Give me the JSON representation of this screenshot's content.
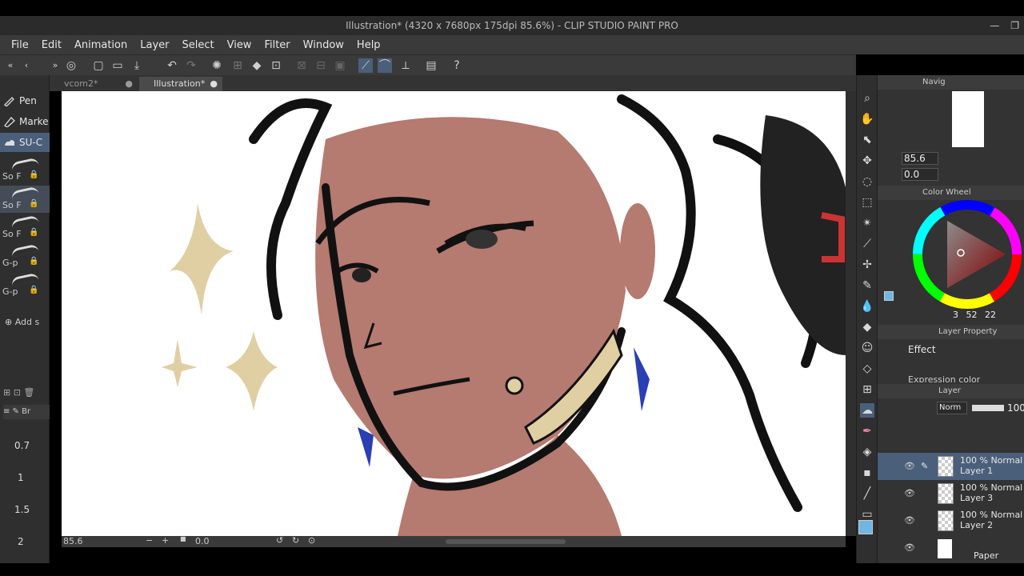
{
  "window": {
    "title": "Illustration* (4320 x 7680px 175dpi 85.6%) - CLIP STUDIO PAINT PRO",
    "minimize": "—",
    "restore": "❐"
  },
  "menu": [
    "File",
    "Edit",
    "Animation",
    "Layer",
    "Select",
    "View",
    "Filter",
    "Window",
    "Help"
  ],
  "left_panel": {
    "tools": [
      {
        "label": "Pen",
        "icon": "pen-icon",
        "selected": false
      },
      {
        "label": "Marke",
        "icon": "marker-icon",
        "selected": false
      },
      {
        "label": "SU-C",
        "icon": "cloud-brush-icon",
        "selected": true
      }
    ],
    "brushes": [
      {
        "label": "So F",
        "selected": false
      },
      {
        "label": "So F",
        "selected": true
      },
      {
        "label": "So F",
        "selected": false
      },
      {
        "label": "G-p",
        "selected": false
      },
      {
        "label": "G-p",
        "selected": false
      }
    ],
    "add_label": "Add s",
    "brush_size_hdr": "Br",
    "sizes": [
      "0.7",
      "1",
      "1.5",
      "2"
    ]
  },
  "doc_tabs": [
    {
      "label": "vcom2*",
      "active": false
    },
    {
      "label": "Illustration*",
      "active": true
    }
  ],
  "canvas_bar": {
    "zoom": "85.6",
    "angle": "0.0"
  },
  "navigator": {
    "tab": "Navig",
    "zoom": "85.6",
    "angle": "0.0"
  },
  "color_wheel": {
    "tab": "Color Wheel",
    "values": [
      "3",
      "52",
      "22"
    ],
    "main_color": "#6fb6e0",
    "sub_color": "#b46a6a"
  },
  "layer_property": {
    "tab": "Layer Property",
    "effect": "Effect",
    "expression_color": "Expression color"
  },
  "layer_panel": {
    "tab": "Layer",
    "blend_mode": "Norm",
    "opacity": "100",
    "layers": [
      {
        "opacity_mode": "100 % Normal",
        "name": "Layer 1",
        "selected": true
      },
      {
        "opacity_mode": "100 % Normal",
        "name": "Layer 3",
        "selected": false
      },
      {
        "opacity_mode": "100 % Normal",
        "name": "Layer 2",
        "selected": false
      },
      {
        "opacity_mode": "",
        "name": "Paper",
        "selected": false
      }
    ]
  }
}
